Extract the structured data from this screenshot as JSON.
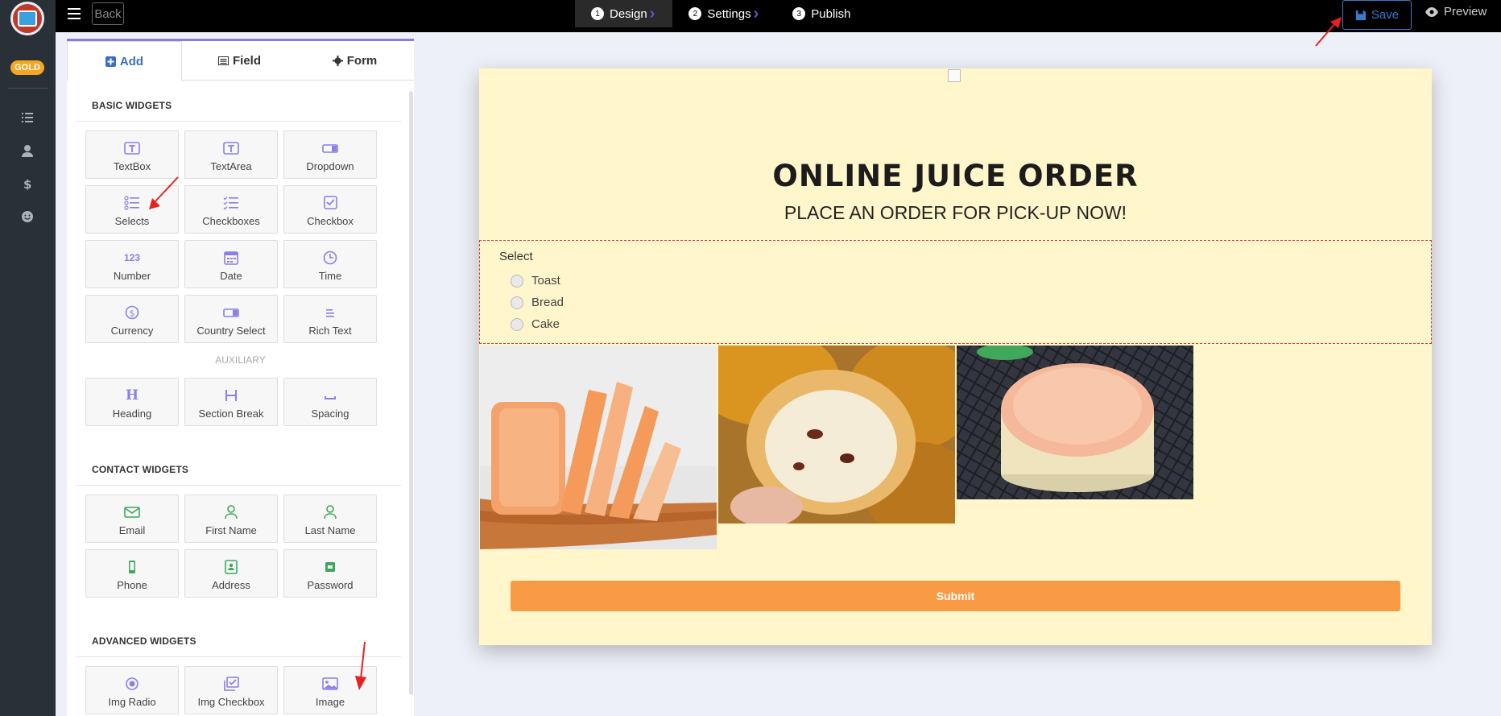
{
  "rail": {
    "badge": "GOLD",
    "icons": [
      "list-icon",
      "user-icon",
      "dollar-icon",
      "smiley-icon"
    ]
  },
  "topbar": {
    "back_label": "Back",
    "steps": [
      {
        "num": "1",
        "label": "Design"
      },
      {
        "num": "2",
        "label": "Settings"
      },
      {
        "num": "3",
        "label": "Publish"
      }
    ],
    "save_label": "Save",
    "preview_label": "Preview"
  },
  "panel": {
    "tabs": [
      {
        "label": "Add",
        "icon": "plus-square-icon"
      },
      {
        "label": "Field",
        "icon": "list-alt-icon"
      },
      {
        "label": "Form",
        "icon": "gear-icon"
      }
    ],
    "basic_title": "BASIC WIDGETS",
    "basic": [
      "TextBox",
      "TextArea",
      "Dropdown",
      "Selects",
      "Checkboxes",
      "Checkbox",
      "Number",
      "Date",
      "Time",
      "Currency",
      "Country Select",
      "Rich Text"
    ],
    "aux_title": "AUXILIARY",
    "auxiliary": [
      "Heading",
      "Section Break",
      "Spacing"
    ],
    "contact_title": "CONTACT WIDGETS",
    "contact": [
      "Email",
      "First Name",
      "Last Name",
      "Phone",
      "Address",
      "Password"
    ],
    "advanced_title": "ADVANCED WIDGETS",
    "advanced": [
      "Img Radio",
      "Img Checkbox",
      "Image"
    ],
    "number_glyph": "123"
  },
  "form": {
    "title": "ONLINE JUICE ORDER",
    "subtitle": "PLACE AN ORDER FOR PICK-UP NOW!",
    "select_label": "Select",
    "options": [
      "Toast",
      "Bread",
      "Cake"
    ],
    "submit_label": "Submit"
  },
  "colors": {
    "accent": "#8a7be0",
    "canvas_bg": "#fff6cc",
    "submit": "#f99a44",
    "save": "#3a78c8",
    "select_border": "#e0373b"
  }
}
